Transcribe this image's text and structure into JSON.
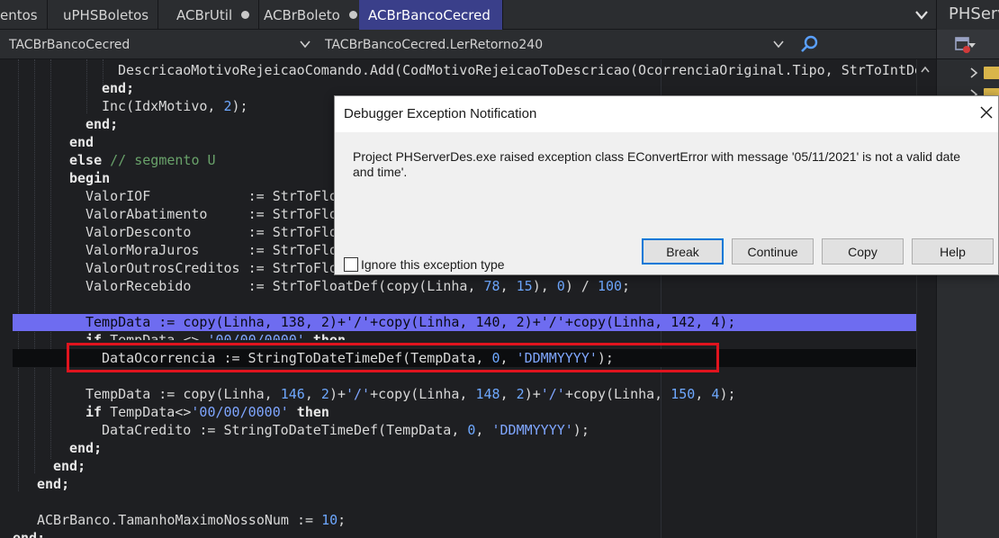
{
  "tabs": [
    {
      "label": "entos",
      "dot": false,
      "active": false
    },
    {
      "label": "uPHSBoletos",
      "dot": false,
      "active": false
    },
    {
      "label": "ACBrUtil",
      "dot": true,
      "active": false
    },
    {
      "label": "ACBrBoleto",
      "dot": true,
      "active": false
    },
    {
      "label": "ACBrBancoCecred",
      "dot": true,
      "active": true
    }
  ],
  "nav": {
    "unit_combo": "TACBrBancoCecred",
    "method_combo": "TACBrBancoCecred.LerRetorno240"
  },
  "right_panel": {
    "title": "PHServer"
  },
  "code": {
    "l1": "DescricaoMotivoRejeicaoComando.Add(CodMotivoRejeicaoToDescricao(OcorrenciaOriginal.Tipo, StrToIntDe",
    "l2": "end;",
    "l3_a": "Inc(IdxMotivo, ",
    "l3_n": "2",
    "l3_b": ");",
    "l4": "end;",
    "l5": "end",
    "l6_kw": "else",
    "l6_cmt": " // segmento U",
    "l7": "begin",
    "l8": "ValorIOF            := StrToFlo",
    "l9": "ValorAbatimento     := StrToFlo",
    "l10": "ValorDesconto       := StrToFlo",
    "l11": "ValorMoraJuros      := StrToFlo",
    "l12": "ValorOutrosCreditos := StrToFlo",
    "l13_a": "ValorRecebido       := StrToFloatDef(copy(Linha, ",
    "l13_n1": "78",
    "l13_b": ", ",
    "l13_n2": "15",
    "l13_c": "), ",
    "l13_n3": "0",
    "l13_d": ") / ",
    "l13_n4": "100",
    "l13_e": ";",
    "l14": "TempData := copy(Linha, 138, 2)+'/'+copy(Linha, 140, 2)+'/'+copy(Linha, 142, 4);",
    "l15_kw": "if",
    "l15_a": " TempData <> ",
    "l15_s": "'00/00/0000'",
    "l15_kw2": " then",
    "l16_a": "DataOcorrencia := StringToDateTimeDef(TempData, ",
    "l16_n": "0",
    "l16_b": ", ",
    "l16_s": "'DDMMYYYY'",
    "l16_c": ");",
    "l17_a": "TempData := copy(Linha, ",
    "l17_n1": "146",
    "l17_b": ", ",
    "l17_n2": "2",
    "l17_c": ")+",
    "l17_s1": "'/'",
    "l17_d": "+copy(Linha, ",
    "l17_n3": "148",
    "l17_e": ", ",
    "l17_n4": "2",
    "l17_f": ")+",
    "l17_s2": "'/'",
    "l17_g": "+copy(Linha, ",
    "l17_n5": "150",
    "l17_h": ", ",
    "l17_n6": "4",
    "l17_i": ");",
    "l18_kw": "if",
    "l18_a": " TempData<>",
    "l18_s": "'00/00/0000'",
    "l18_kw2": " then",
    "l19_a": "DataCredito := StringToDateTimeDef(TempData, ",
    "l19_n": "0",
    "l19_b": ", ",
    "l19_s": "'DDMMYYYY'",
    "l19_c": ");",
    "l20": "end;",
    "l21": "end;",
    "l22": "end;",
    "l23_a": "ACBrBanco.TamanhoMaximoNossoNum := ",
    "l23_n": "10",
    "l23_b": ";",
    "l24": "end;"
  },
  "dialog": {
    "title": "Debugger Exception Notification",
    "message": "Project PHServerDes.exe raised exception class EConvertError with message '05/11/2021' is not a valid date and time'.",
    "buttons": {
      "break": "Break",
      "continue": "Continue",
      "copy": "Copy",
      "help": "Help"
    },
    "ignore_checkbox_label": "Ignore this exception type",
    "ignore_checked": false
  },
  "colors": {
    "execution_line": "#6e6cf0",
    "highlight_box": "#e0141e",
    "active_tab": "#3a3f8a"
  }
}
